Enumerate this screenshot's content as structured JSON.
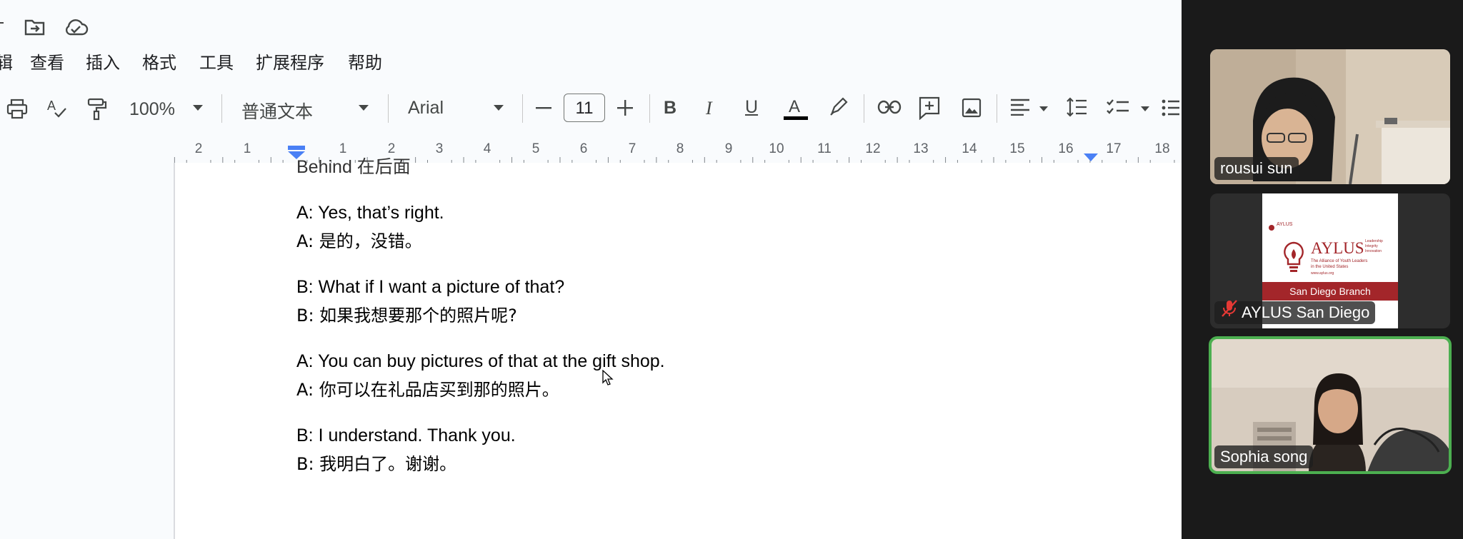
{
  "menu": {
    "items": [
      "辑",
      "查看",
      "插入",
      "格式",
      "工具",
      "扩展程序",
      "帮助"
    ]
  },
  "toolbar": {
    "zoom": "100%",
    "style": "普通文本",
    "font": "Arial",
    "font_size": "11"
  },
  "ruler": {
    "numbers": [
      "2",
      "1",
      "1",
      "2",
      "3",
      "4",
      "5",
      "6",
      "7",
      "8",
      "9",
      "10",
      "11",
      "12",
      "13",
      "14",
      "15",
      "16",
      "17",
      "18"
    ]
  },
  "document": {
    "partial_line": "Behind 在后面",
    "lines": [
      {
        "text": "A: Yes, that’s right."
      },
      {
        "text": "A: 是的，没错。"
      },
      {
        "text": "B: What if I want a picture of that?"
      },
      {
        "text": "B: 如果我想要那个的照片呢?"
      },
      {
        "text": "A: You can buy pictures of that at the gift shop."
      },
      {
        "text": "A: 你可以在礼品店买到那的照片。"
      },
      {
        "text": "B: I understand. Thank you."
      },
      {
        "text": "B: 我明白了。谢谢。"
      }
    ]
  },
  "participants": [
    {
      "name": "rousui sun",
      "muted": false,
      "active": false
    },
    {
      "name": "AYLUS San Diego",
      "muted": true,
      "active": false,
      "logo": {
        "small": "AYLUS",
        "big": "AYLUS",
        "tag1": "The Alliance of Youth Leaders",
        "tag2": "in the United States",
        "side": "Leadership Integrity Innovation",
        "url": "www.aylus.org",
        "branch": "San Diego Branch"
      }
    },
    {
      "name": "Sophia song",
      "muted": false,
      "active": true
    }
  ],
  "colors": {
    "active_border": "#4caf50",
    "brand_red": "#a3262a",
    "muted_icon": "#e53935",
    "ruler_marker": "#4a80f5"
  }
}
